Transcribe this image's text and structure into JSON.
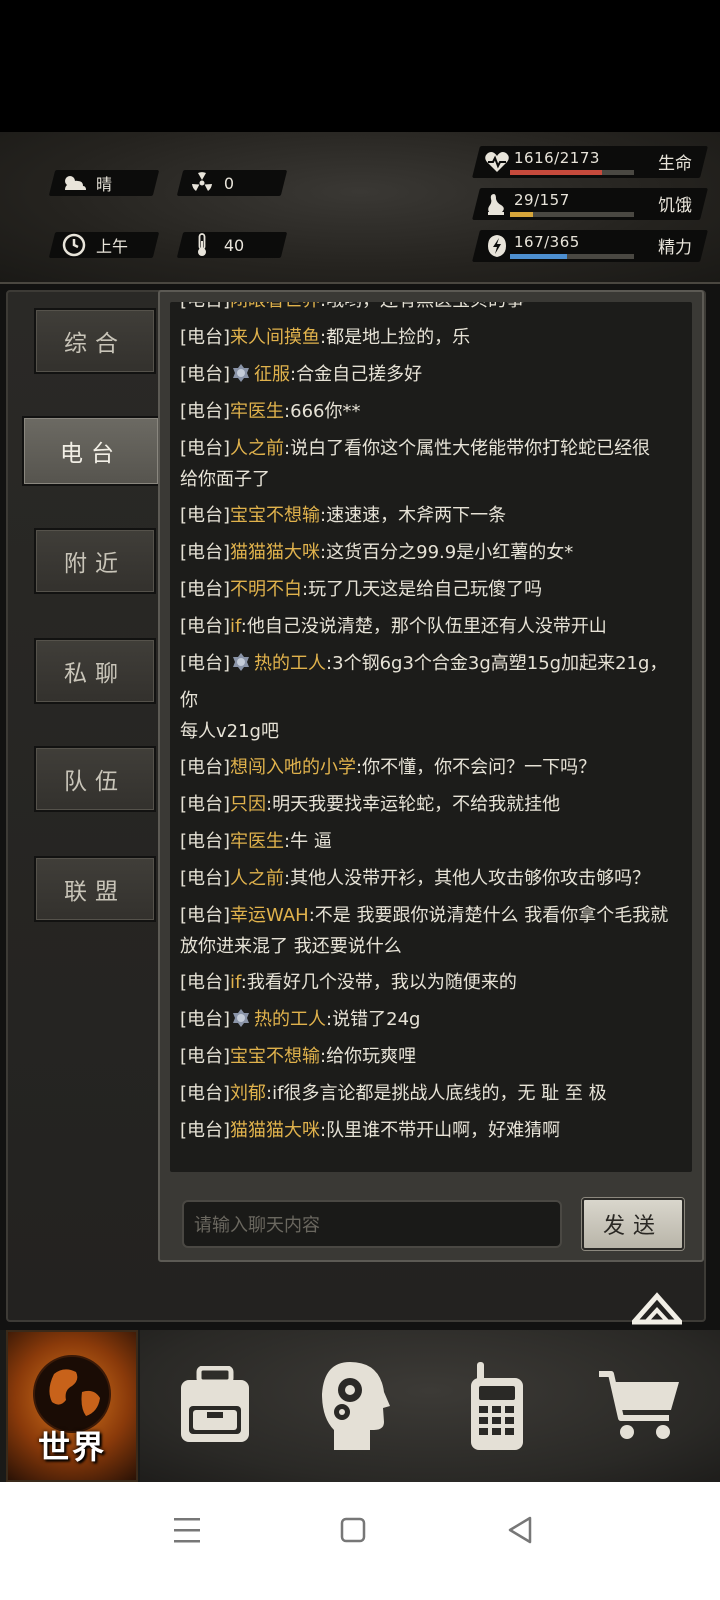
{
  "status": {
    "weather": "晴",
    "radiation": "0",
    "time_of_day": "上午",
    "temperature": "40",
    "vitals": [
      {
        "label": "生命",
        "value": "1616/2173",
        "fraction": 0.744,
        "color": "#c64a3c",
        "icon": "heart-pulse-icon"
      },
      {
        "label": "饥饿",
        "value": "29/157",
        "fraction": 0.185,
        "color": "#d6a53a",
        "icon": "stomach-icon"
      },
      {
        "label": "精力",
        "value": "167/365",
        "fraction": 0.457,
        "color": "#4d8fd1",
        "icon": "energy-icon"
      }
    ]
  },
  "tabs": [
    {
      "label": "综合",
      "active": false
    },
    {
      "label": "电台",
      "active": true
    },
    {
      "label": "附近",
      "active": false
    },
    {
      "label": "私聊",
      "active": false
    },
    {
      "label": "队伍",
      "active": false
    },
    {
      "label": "联盟",
      "active": false
    }
  ],
  "chat": {
    "channel_label": "[电台]",
    "messages": [
      {
        "sender": "闭眼看世界",
        "text": ":哦哟，还有黑医宝贝的事",
        "badge": false,
        "cut": true
      },
      {
        "sender": "来人间摸鱼",
        "text": ":都是地上捡的，乐",
        "badge": false
      },
      {
        "sender": "征服",
        "text": ":合金自己搓多好",
        "badge": true
      },
      {
        "sender": "牢医生",
        "text": ":666你**",
        "badge": false
      },
      {
        "sender": "人之前",
        "text": ":说白了看你这个属性大佬能带你打轮蛇已经很",
        "wrap": "给你面子了",
        "badge": false
      },
      {
        "sender": "宝宝不想输",
        "text": ":速速速，木斧两下一条",
        "badge": false
      },
      {
        "sender": "猫猫猫大咪",
        "text": ":这货百分之99.9是小红薯的女*",
        "badge": false
      },
      {
        "sender": "不明不白",
        "text": ":玩了几天这是给自己玩傻了吗",
        "badge": false
      },
      {
        "sender": "if",
        "text": ":他自己没说清楚，那个队伍里还有人没带开山",
        "badge": false
      },
      {
        "sender": "热的工人",
        "text": ":3个钢6g3个合金3g高塑15g加起来21g，你",
        "wrap": "每人v21g吧",
        "badge": true
      },
      {
        "sender": "想闯入吔的小学",
        "text": ":你不懂，你不会问？一下吗？",
        "badge": false
      },
      {
        "sender": "只因",
        "text": ":明天我要找幸运轮蛇，不给我就挂他",
        "badge": false
      },
      {
        "sender": "牢医生",
        "text": ":牛 逼",
        "badge": false
      },
      {
        "sender": "人之前",
        "text": ":其他人没带开衫，其他人攻击够你攻击够吗？",
        "badge": false
      },
      {
        "sender": "幸运WAH",
        "text": ":不是 我要跟你说清楚什么 我看你拿个毛我就",
        "wrap": "放你进来混了 我还要说什么",
        "badge": false
      },
      {
        "sender": "if",
        "text": ":我看好几个没带，我以为随便来的",
        "badge": false
      },
      {
        "sender": "热的工人",
        "text": ":说错了24g",
        "badge": true
      },
      {
        "sender": "宝宝不想输",
        "text": ":给你玩爽哩",
        "badge": false
      },
      {
        "sender": "刘郁",
        "text": ":if很多言论都是挑战人底线的，无 耻 至 极",
        "badge": false
      },
      {
        "sender": "猫猫猫大咪",
        "text": ":队里谁不带开山啊，好难猜啊",
        "badge": false
      }
    ],
    "input_placeholder": "请输入聊天内容",
    "send_label": "发送"
  },
  "bottom_nav": {
    "world_label": "世界",
    "items": [
      "backpack-icon",
      "skills-head-icon",
      "radio-icon",
      "cart-icon"
    ]
  }
}
